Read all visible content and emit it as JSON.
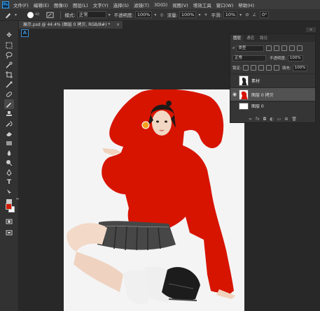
{
  "menubar": {
    "logo": "Ps",
    "items": [
      "文件(F)",
      "编辑(E)",
      "图像(I)",
      "图层(L)",
      "文字(Y)",
      "选择(S)",
      "滤镜(T)",
      "3D(D)",
      "视图(V)",
      "增效工具",
      "窗口(W)",
      "帮助(H)"
    ]
  },
  "options": {
    "brush_size": "40",
    "mode_label": "模式:",
    "mode_value": "正常",
    "opacity_label": "不透明度:",
    "opacity_value": "100%",
    "flow_label": "流量:",
    "flow_value": "100%",
    "smooth_label": "平滑:",
    "smooth_value": "10%",
    "angle_value": "0°"
  },
  "document": {
    "tab_label": "展示.psd @ 44.4% (图层 0 拷贝, RGB/8#) *",
    "close_glyph": "×",
    "artboard_glyph": "A"
  },
  "colors": {
    "foreground": "#d51a00",
    "background": "#ffffff",
    "paint_red": "#d71400"
  },
  "layers_panel": {
    "tabs": [
      "图层",
      "通道",
      "路径"
    ],
    "filter_label": "类型",
    "blend_mode": "正常",
    "opacity_label": "不透明度:",
    "opacity_value": "100%",
    "lock_label": "锁定:",
    "fill_label": "填充:",
    "fill_value": "100%",
    "layers": [
      {
        "name": "素材",
        "visible": false,
        "active": false
      },
      {
        "name": "图层 0 拷贝",
        "visible": true,
        "active": true
      },
      {
        "name": "图层 0",
        "visible": false,
        "active": false
      }
    ],
    "footer_icons": [
      "link-icon",
      "fx-icon",
      "mask-icon",
      "adjustment-icon",
      "group-icon",
      "new-layer-icon",
      "trash-icon"
    ]
  },
  "toolbar": {
    "tools": [
      "move-icon",
      "marquee-icon",
      "lasso-icon",
      "quick-select-icon",
      "crop-icon",
      "eyedropper-icon",
      "brush-icon",
      "eraser-icon",
      "stamp-icon",
      "history-brush-icon",
      "gradient-icon",
      "blur-icon",
      "dodge-icon",
      "pen-icon",
      "type-icon",
      "path-select-icon",
      "shape-icon",
      "hand-icon",
      "zoom-icon",
      "more-icon"
    ]
  }
}
